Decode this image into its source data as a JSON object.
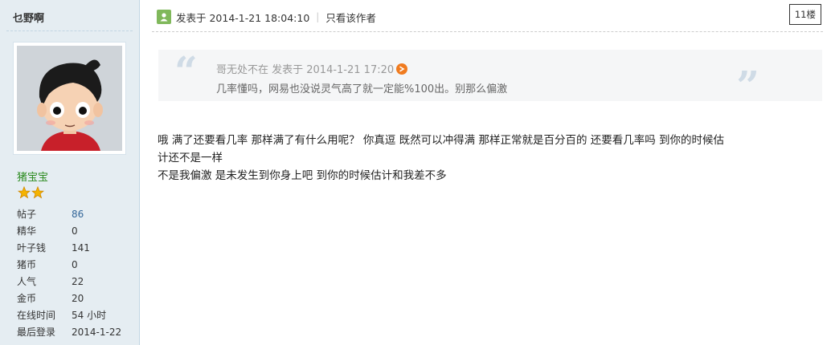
{
  "author": {
    "name": "乜野啊",
    "group": "猪宝宝",
    "stats": [
      {
        "label": "帖子",
        "value": "86"
      },
      {
        "label": "精华",
        "value": "0"
      },
      {
        "label": "叶子钱",
        "value": "141"
      },
      {
        "label": "猪币",
        "value": "0"
      },
      {
        "label": "人气",
        "value": "22"
      },
      {
        "label": "金币",
        "value": "20"
      },
      {
        "label": "在线时间",
        "value": "54 小时"
      },
      {
        "label": "最后登录",
        "value": "2014-1-22"
      }
    ],
    "star_count": 2
  },
  "post": {
    "time": "发表于 2014-1-21 18:04:10",
    "separator": "|",
    "only_author": "只看该作者",
    "floor": "11楼",
    "quote": {
      "meta": "哥无处不在 发表于 2014-1-21 17:20",
      "text": "几率懂吗，网易也没说灵气高了就一定能%100出。别那么偏激"
    },
    "body_line1": "哦  满了还要看几率  那样满了有什么用呢？  你真逗  既然可以冲得满  那样正常就是百分百的  还要看几率吗    到你的时候估",
    "body_line2": "计还不是一样",
    "body_line3": "不是我偏激  是未发生到你身上吧    到你的时候估计和我差不多"
  },
  "colors": {
    "sidebar_bg": "#e5edf2",
    "group_green": "#2b8a1f",
    "link_blue": "#336699",
    "star_gold": "#f5b400"
  }
}
